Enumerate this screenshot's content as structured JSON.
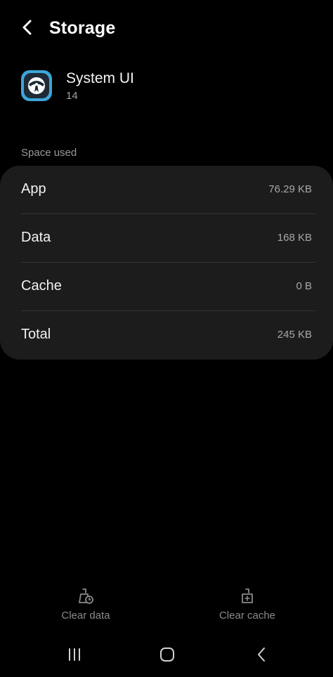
{
  "header": {
    "title": "Storage",
    "back_icon": "chevron-left-icon"
  },
  "app": {
    "name": "System UI",
    "version": "14",
    "icon": "system-ui-app-icon",
    "icon_color": "#3da6d9"
  },
  "space_used": {
    "section_label": "Space used",
    "rows": [
      {
        "label": "App",
        "value": "76.29 KB"
      },
      {
        "label": "Data",
        "value": "168 KB"
      },
      {
        "label": "Cache",
        "value": "0 B"
      },
      {
        "label": "Total",
        "value": "245 KB"
      }
    ]
  },
  "actions": {
    "clear_data": {
      "label": "Clear data",
      "icon": "clear-data-icon",
      "enabled": false
    },
    "clear_cache": {
      "label": "Clear cache",
      "icon": "clear-cache-icon",
      "enabled": false
    }
  },
  "navbar": {
    "recents_icon": "recents-icon",
    "home_icon": "home-icon",
    "back_icon": "back-icon"
  },
  "colors": {
    "background": "#000000",
    "card": "#1c1c1c",
    "disabled_text": "#8a8a8a"
  }
}
